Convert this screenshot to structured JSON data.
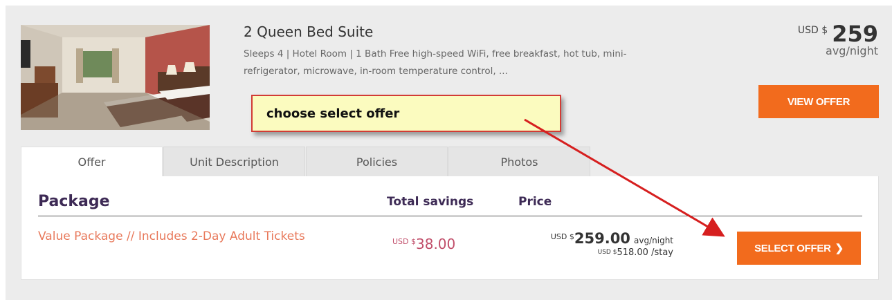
{
  "room": {
    "title": "2 Queen Bed Suite",
    "description": "Sleeps 4 | Hotel Room | 1 Bath Free high-speed WiFi, free breakfast, hot tub, mini-refrigerator, microwave, in-room temperature control, ..."
  },
  "header_price": {
    "currency": "USD $",
    "amount": "259",
    "per": "avg/night"
  },
  "view_offer_label": "VIEW OFFER",
  "annotation": {
    "text": "choose select offer"
  },
  "tabs": [
    {
      "label": "Offer",
      "active": true
    },
    {
      "label": "Unit Description",
      "active": false
    },
    {
      "label": "Policies",
      "active": false
    },
    {
      "label": "Photos",
      "active": false
    }
  ],
  "offer_table": {
    "headers": {
      "package": "Package",
      "savings": "Total savings",
      "price": "Price"
    },
    "row": {
      "package_name": "Value Package // Includes 2-Day Adult Tickets",
      "savings_currency": "USD $",
      "savings_amount": "38.00",
      "price_currency": "USD $",
      "price_amount": "259.00",
      "price_per": "avg/night",
      "stay_currency": "USD $",
      "stay_amount": "518.00",
      "stay_per": "/stay"
    },
    "select_label": "SELECT OFFER",
    "select_chevron": "❯"
  },
  "colors": {
    "accent_orange": "#f26b1d",
    "header_purple": "#3d2a55",
    "package_link": "#e8785a",
    "savings_red": "#c14e6a",
    "annotation_border": "#d23b35",
    "annotation_fill": "#fbfbbf"
  }
}
